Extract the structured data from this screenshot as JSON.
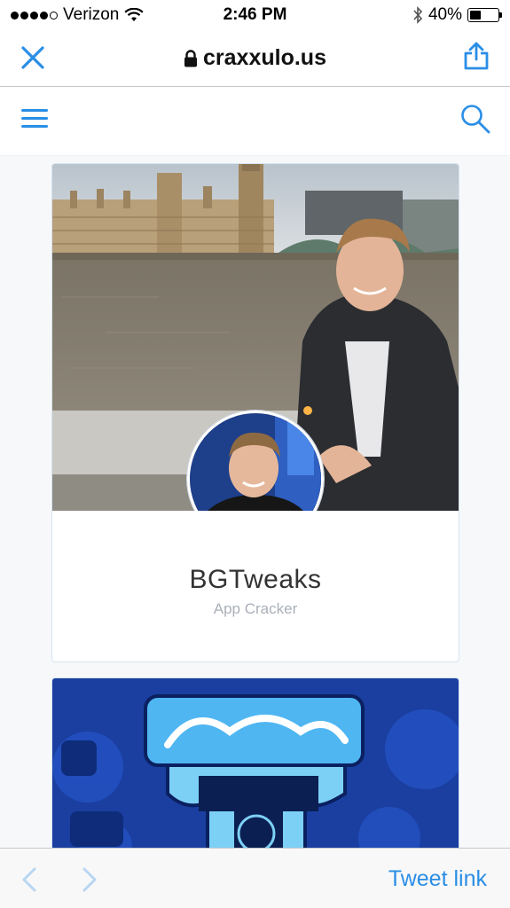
{
  "status_bar": {
    "carrier": "Verizon",
    "time": "2:46 PM",
    "battery_percent": "40%",
    "battery_level": 0.4,
    "signal_bars_filled": 4,
    "signal_bars_total": 5
  },
  "browser": {
    "close_icon": "close-icon",
    "lock_icon": "lock-icon",
    "domain": "craxxulo.us",
    "share_icon": "share-icon",
    "accent_color": "#2a8ee6"
  },
  "site_nav": {
    "menu_icon": "hamburger-menu-icon",
    "search_icon": "search-icon"
  },
  "cards": [
    {
      "name": "BGTweaks",
      "role": "App Cracker",
      "cover_description_icon": "cover-photo",
      "avatar_icon": "avatar"
    },
    {
      "cover_description_icon": "cover-photo"
    }
  ],
  "bottom_bar": {
    "back_icon": "chevron-left-icon",
    "forward_icon": "chevron-right-icon",
    "tweet_label": "Tweet link"
  }
}
